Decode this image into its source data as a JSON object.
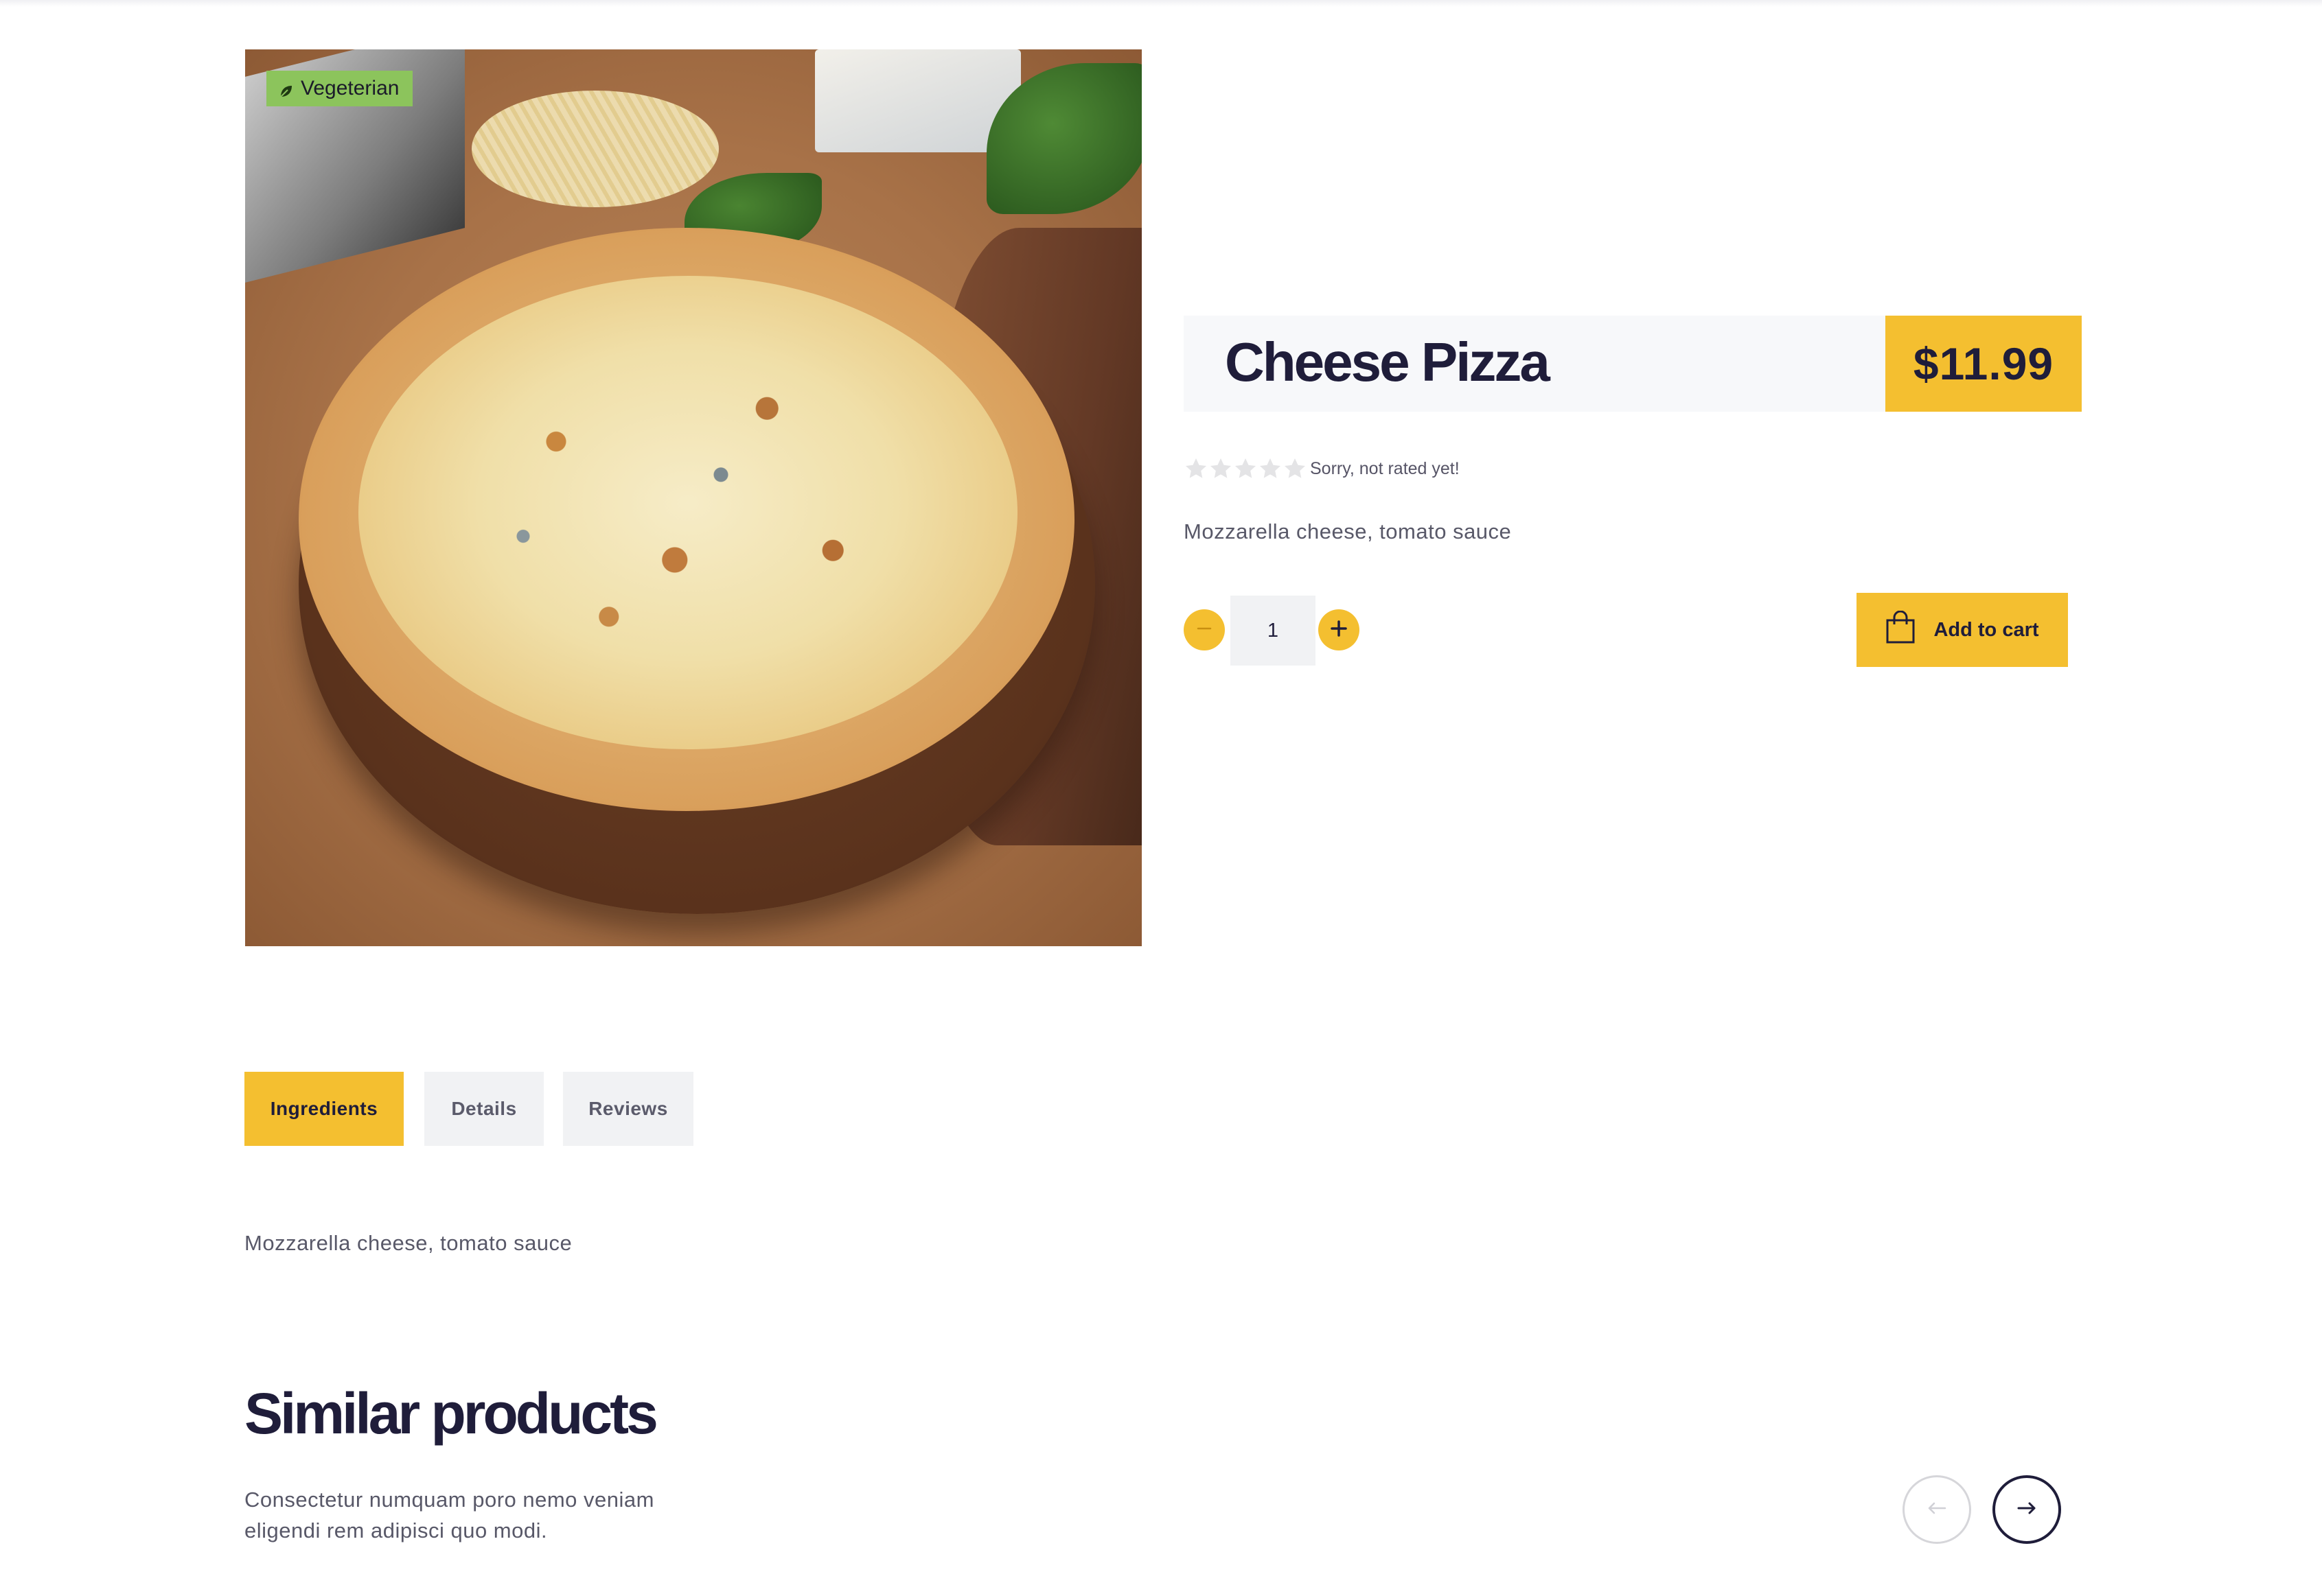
{
  "product": {
    "badge": "Vegeterian",
    "title": "Cheese Pizza",
    "price": "$11.99",
    "rating": {
      "value": 0,
      "max": 5,
      "text": "Sorry, not rated yet!"
    },
    "short_description": "Mozzarella cheese, tomato sauce",
    "quantity": "1",
    "add_to_cart_label": "Add to cart"
  },
  "tabs": [
    {
      "label": "Ingredients",
      "active": true
    },
    {
      "label": "Details",
      "active": false
    },
    {
      "label": "Reviews",
      "active": false
    }
  ],
  "tab_content": "Mozzarella cheese, tomato sauce",
  "similar": {
    "title": "Similar products",
    "description": "Consectetur numquam poro nemo veniam eligendi rem adipisci quo modi."
  },
  "icons": {
    "badge": "leaf-icon",
    "minus": "minus-icon",
    "plus": "plus-icon",
    "cart": "shopping-bag-icon",
    "prev": "arrow-left-icon",
    "next": "arrow-right-icon",
    "star": "star-icon"
  },
  "colors": {
    "accent": "#f4bf30",
    "badge": "#8cc45c",
    "heading": "#1f1d3a",
    "text": "#585868",
    "star_empty": "#e4e4e6"
  }
}
